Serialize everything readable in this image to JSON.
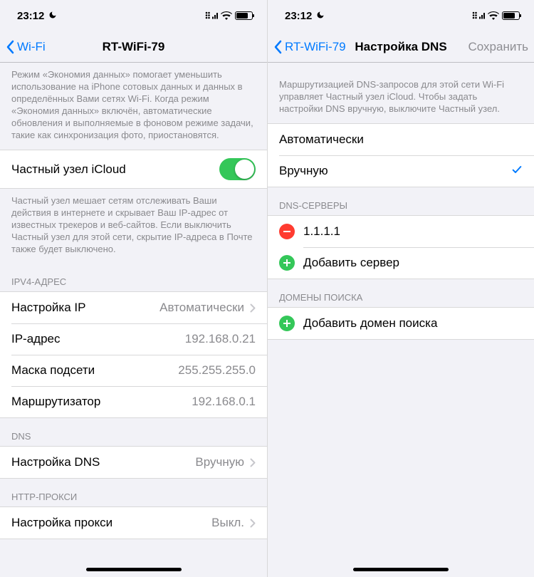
{
  "statusbar": {
    "time": "23:12"
  },
  "left": {
    "nav": {
      "back": "Wi-Fi",
      "title": "RT-WiFi-79"
    },
    "dataSaverFooter": "Режим «Экономия данных» помогает уменьшить использование на iPhone сотовых данных и данных в определённых Вами сетях Wi‑Fi. Когда режим «Экономия данных» включён, автоматические обновления и выполняемые в фоновом режиме задачи, такие как синхронизация фото, приостановятся.",
    "privateRelay": {
      "label": "Частный узел iCloud"
    },
    "privateRelayFooter": "Частный узел мешает сетям отслеживать Ваши действия в интернете и скрывает Ваш IP‑адрес от известных трекеров и веб‑сайтов. Если выключить Частный узел для этой сети, скрытие IP‑адреса в Почте также будет выключено.",
    "ipv4": {
      "header": "IPV4-АДРЕС",
      "configure": {
        "label": "Настройка IP",
        "value": "Автоматически"
      },
      "ip": {
        "label": "IP-адрес",
        "value": "192.168.0.21"
      },
      "mask": {
        "label": "Маска подсети",
        "value": "255.255.255.0"
      },
      "router": {
        "label": "Маршрутизатор",
        "value": "192.168.0.1"
      }
    },
    "dns": {
      "header": "DNS",
      "configure": {
        "label": "Настройка DNS",
        "value": "Вручную"
      }
    },
    "proxy": {
      "header": "HTTP-ПРОКСИ",
      "configure": {
        "label": "Настройка прокси",
        "value": "Выкл."
      }
    }
  },
  "right": {
    "nav": {
      "back": "RT-WiFi-79",
      "title": "Настройка DNS",
      "save": "Сохранить"
    },
    "info": "Маршрутизацией DNS-запросов для этой сети Wi‑Fi управляет Частный узел iCloud. Чтобы задать настройки DNS вручную, выключите Частный узел.",
    "mode": {
      "auto": "Автоматически",
      "manual": "Вручную"
    },
    "servers": {
      "header": "DNS-СЕРВЕРЫ",
      "item0": "1.1.1.1",
      "add": "Добавить сервер"
    },
    "search": {
      "header": "ДОМЕНЫ ПОИСКА",
      "add": "Добавить домен поиска"
    }
  }
}
